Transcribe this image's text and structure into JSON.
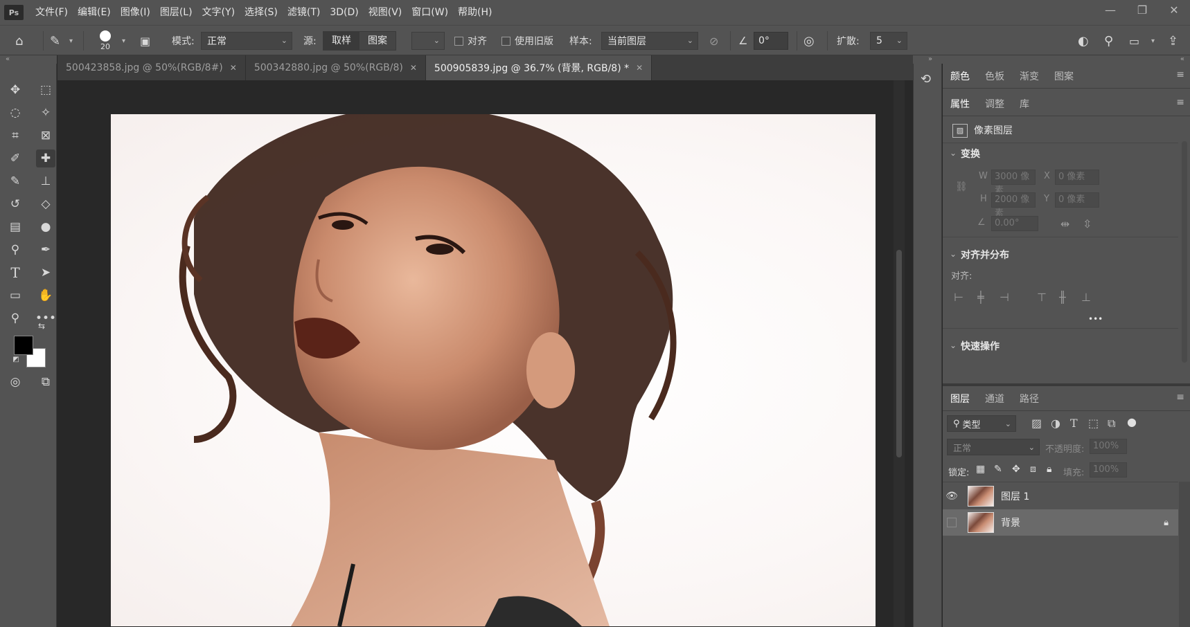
{
  "app": {
    "logo": "Ps",
    "menu": [
      "文件(F)",
      "编辑(E)",
      "图像(I)",
      "图层(L)",
      "文字(Y)",
      "选择(S)",
      "滤镜(T)",
      "3D(D)",
      "视图(V)",
      "窗口(W)",
      "帮助(H)"
    ],
    "window_controls": [
      "minimize-icon",
      "restore-icon",
      "close-icon"
    ]
  },
  "options": {
    "brush_size": "20",
    "mode_label": "模式:",
    "mode_value": "正常",
    "source_label": "源:",
    "source_sample": "取样",
    "source_pattern": "图案",
    "aligned_label": "对齐",
    "legacy_label": "使用旧版",
    "sample_label": "样本:",
    "sample_value": "当前图层",
    "angle_value": "0°",
    "diffusion_label": "扩散:",
    "diffusion_value": "5"
  },
  "tabs": [
    {
      "label": "500423858.jpg @ 50%(RGB/8#)",
      "active": false
    },
    {
      "label": "500342880.jpg @ 50%(RGB/8)",
      "active": false
    },
    {
      "label": "500905839.jpg @ 36.7% (背景, RGB/8) *",
      "active": true
    }
  ],
  "colors": {
    "foreground": "#000000",
    "background": "#ffffff"
  },
  "top_panel": {
    "tabs": [
      "颜色",
      "色板",
      "渐变",
      "图案"
    ]
  },
  "properties": {
    "tabs": [
      "属性",
      "调整",
      "库"
    ],
    "layer_type": "像素图层",
    "transform_title": "变换",
    "w_label": "W",
    "w_value": "3000 像素",
    "x_label": "X",
    "x_value": "0 像素",
    "h_label": "H",
    "h_value": "2000 像素",
    "y_label": "Y",
    "y_value": "0 像素",
    "angle_value": "0.00°",
    "align_title": "对齐并分布",
    "align_label": "对齐:",
    "more": "•••",
    "quick_title": "快速操作"
  },
  "layers_panel": {
    "tabs": [
      "图层",
      "通道",
      "路径"
    ],
    "filter_kind": "类型",
    "blend_mode": "正常",
    "opacity_label": "不透明度:",
    "opacity_value": "100%",
    "lock_label": "锁定:",
    "fill_label": "填充:",
    "fill_value": "100%",
    "layers": [
      {
        "name": "图层 1",
        "visible": true,
        "selected": false,
        "locked": false
      },
      {
        "name": "背景",
        "visible": false,
        "selected": true,
        "locked": true
      }
    ]
  }
}
